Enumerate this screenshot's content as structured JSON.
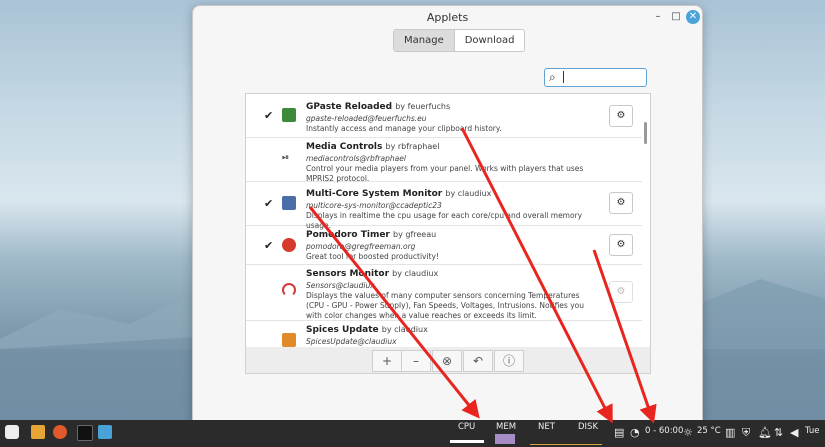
{
  "window": {
    "title": "Applets",
    "buttons": {
      "minimize": "–",
      "maximize": "□",
      "close": "✕"
    },
    "tabs": [
      {
        "label": "Manage",
        "active": true
      },
      {
        "label": "Download",
        "active": false
      }
    ]
  },
  "search": {
    "placeholder": "",
    "value": ""
  },
  "applets": [
    {
      "name": "GPaste Reloaded",
      "by": "by feuerfuchs",
      "uuid": "gpaste-reloaded@feuerfuchs.eu",
      "desc": "Instantly access and manage your clipboard history.",
      "checked": true,
      "configurable": true,
      "icon": "clipboard-icon",
      "color": "#3a8a3a"
    },
    {
      "name": "Media Controls",
      "by": "by rbfraphael",
      "uuid": "mediacontrols@rbfraphael",
      "desc": "Control your media players from your panel. Works with players that uses MPRIS2 protocol.",
      "checked": false,
      "configurable": false,
      "icon": "play-pause-icon",
      "color": "#444444"
    },
    {
      "name": "Multi-Core System Monitor",
      "by": "by claudiux",
      "uuid": "multicore-sys-monitor@ccadeptic23",
      "desc": "Displays in realtime the cpu usage for each core/cpu and overall memory usage.",
      "checked": true,
      "configurable": true,
      "icon": "monitor-icon",
      "color": "#4a6fa8"
    },
    {
      "name": "Pomodoro Timer",
      "by": "by gfreeau",
      "uuid": "pomodoro@gregfreeman.org",
      "desc": "Great tool for boosted productivity!",
      "checked": true,
      "configurable": true,
      "icon": "tomato-icon",
      "color": "#d63b2a"
    },
    {
      "name": "Sensors Monitor",
      "by": "by claudiux",
      "uuid": "Sensors@claudiux",
      "desc": "Displays the values of many computer sensors concerning Temperatures (CPU - GPU - Power Supply), Fan Speeds, Voltages, Intrusions. Notifies you with color changes when a value reaches or exceeds its limit.",
      "checked": false,
      "configurable": true,
      "icon": "gauge-icon",
      "color": "#d43a3a"
    },
    {
      "name": "Spices Update",
      "by": "by claudiux",
      "uuid": "SpicesUpdate@claudiux",
      "desc": "",
      "checked": false,
      "configurable": true,
      "icon": "spices-icon",
      "color": "#e08a2a"
    }
  ],
  "toolbar": {
    "add": "+",
    "remove": "–",
    "disable": "⊗",
    "undo": "↶",
    "info": "ⓘ"
  },
  "panel": {
    "cpu_label": "CPU",
    "mem_label": "MEM",
    "net_label": "NET",
    "disk_label": "DISK",
    "timer": "0 - 60:00",
    "weather": "25 °C",
    "clock": "Tue"
  }
}
